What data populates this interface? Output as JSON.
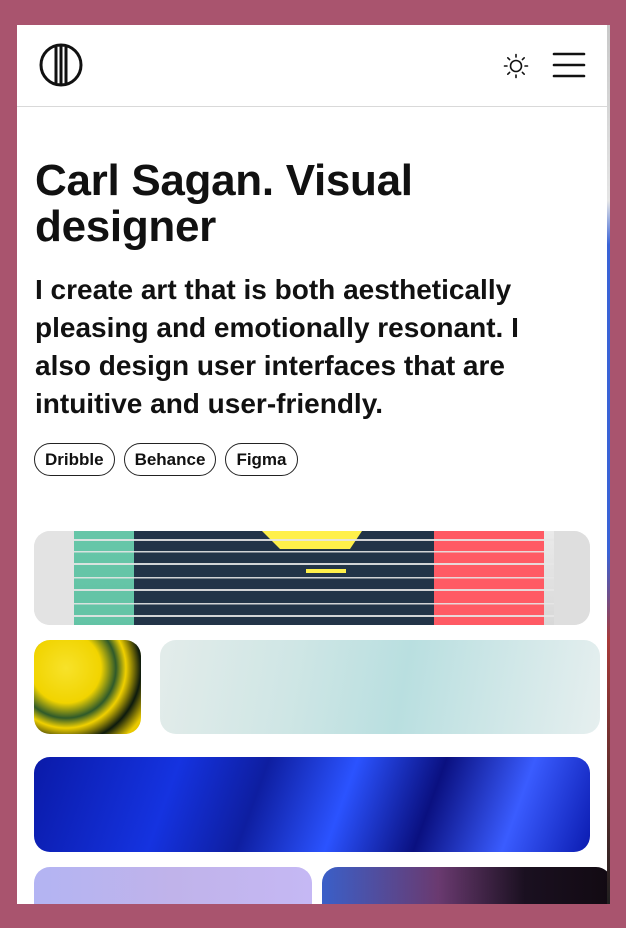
{
  "header": {
    "logo_icon": "circle-stripes-logo-icon",
    "theme_toggle_icon": "sun-icon",
    "menu_icon": "hamburger-menu-icon"
  },
  "hero": {
    "title": "Carl Sagan. Visual designer",
    "intro": "I create art that is both aesthetically pleasing and emotionally resonant. I also design user interfaces that are intuitive and user-friendly."
  },
  "links": [
    {
      "label": "Dribble"
    },
    {
      "label": "Behance"
    },
    {
      "label": "Figma"
    }
  ],
  "gallery": [
    {
      "name": "glitch-stripes-artwork"
    },
    {
      "name": "yellow-marble-artwork"
    },
    {
      "name": "teal-smoke-artwork"
    },
    {
      "name": "blue-glass-waves-artwork"
    },
    {
      "name": "lilac-portrait-artwork"
    },
    {
      "name": "neon-portrait-artwork"
    }
  ],
  "colors": {
    "page_background": "#a9546e",
    "text": "#111111",
    "card_background": "#ffffff"
  }
}
